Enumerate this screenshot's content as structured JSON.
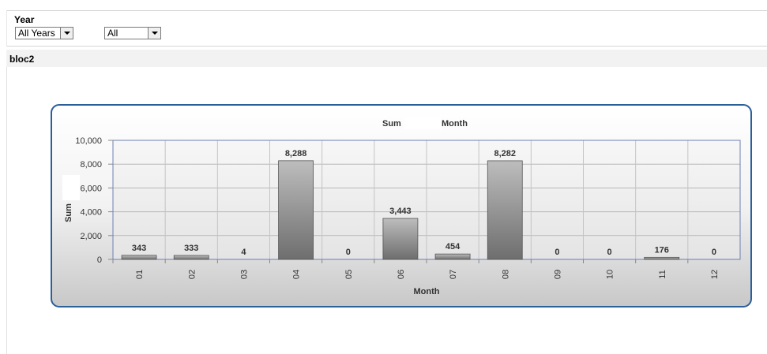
{
  "filters": {
    "title": "Year",
    "year_select": {
      "value": "All Years"
    },
    "second_select": {
      "value": "All"
    }
  },
  "bloc": {
    "title": "bloc2"
  },
  "chart_data": {
    "type": "bar",
    "title_left": "Sum",
    "title_right": "Month",
    "xlabel": "Month",
    "ylabel": "Sum",
    "categories": [
      "01",
      "02",
      "03",
      "04",
      "05",
      "06",
      "07",
      "08",
      "09",
      "10",
      "11",
      "12"
    ],
    "values": [
      343,
      333,
      4,
      8288,
      0,
      3443,
      454,
      8282,
      0,
      0,
      176,
      0
    ],
    "data_labels": [
      "343",
      "333",
      "4",
      "8,288",
      "0",
      "3,443",
      "454",
      "8,282",
      "0",
      "0",
      "176",
      "0"
    ],
    "ylim": [
      0,
      10000
    ],
    "yticks": [
      0,
      2000,
      4000,
      6000,
      8000,
      10000
    ],
    "ytick_labels": [
      "0",
      "2,000",
      "4,000",
      "6,000",
      "8,000",
      "10,000"
    ],
    "grid": true,
    "colors": {
      "bar_light": "#bdbdbd",
      "bar_dark": "#6e6e6e",
      "frame": "#2a5f9a",
      "plot_border": "#6b7fb3"
    }
  }
}
